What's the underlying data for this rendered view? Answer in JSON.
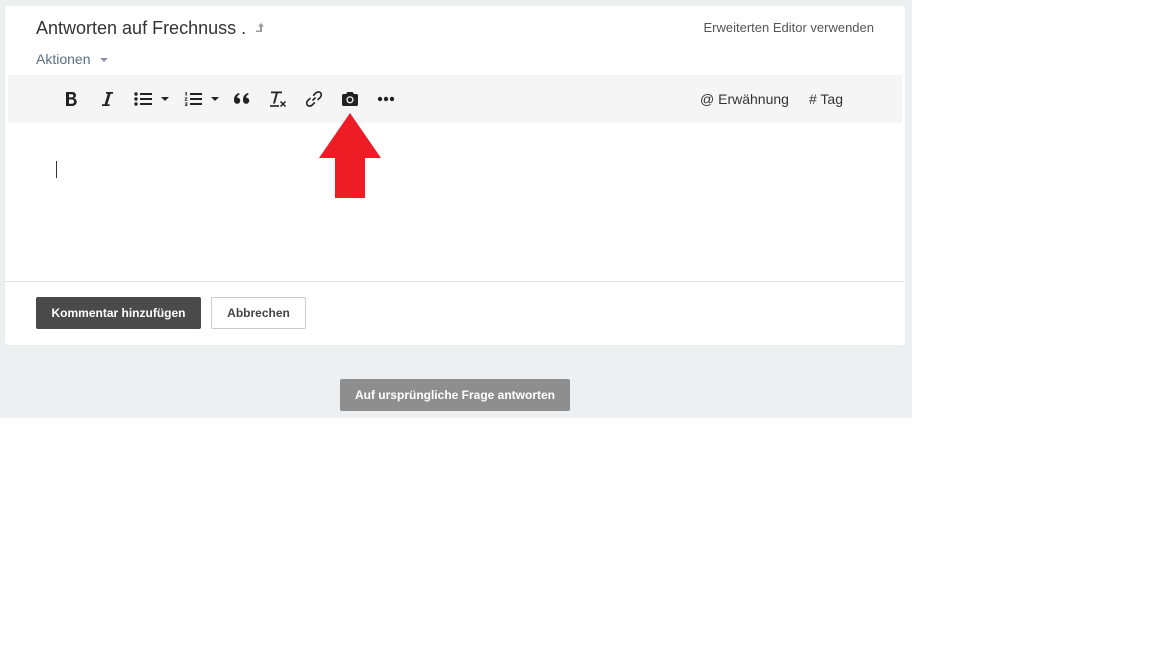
{
  "reply": {
    "title": "Antworten auf Frechnuss .",
    "advanced_editor": "Erweiterten Editor verwenden",
    "actions_label": "Aktionen"
  },
  "toolbar": {
    "buttons": [
      "bold-icon",
      "italic-icon",
      "bullet-list-icon",
      "numbered-list-icon",
      "quote-icon",
      "clear-format-icon",
      "link-icon",
      "camera-icon",
      "more-icon"
    ],
    "mention_label": "@ Erwähnung",
    "tag_label": "# Tag"
  },
  "footer": {
    "add_comment_label": "Kommentar hinzufügen",
    "cancel_label": "Abbrechen",
    "reply_original_label": "Auf ursprüngliche Frage antworten"
  },
  "colors": {
    "page_bg": "#eeeff1",
    "primary_button": "#4a4a4a",
    "disabled_button": "#8e8e8e",
    "annotation_arrow": "#ee1c24",
    "actions_link": "#5a6f86"
  }
}
